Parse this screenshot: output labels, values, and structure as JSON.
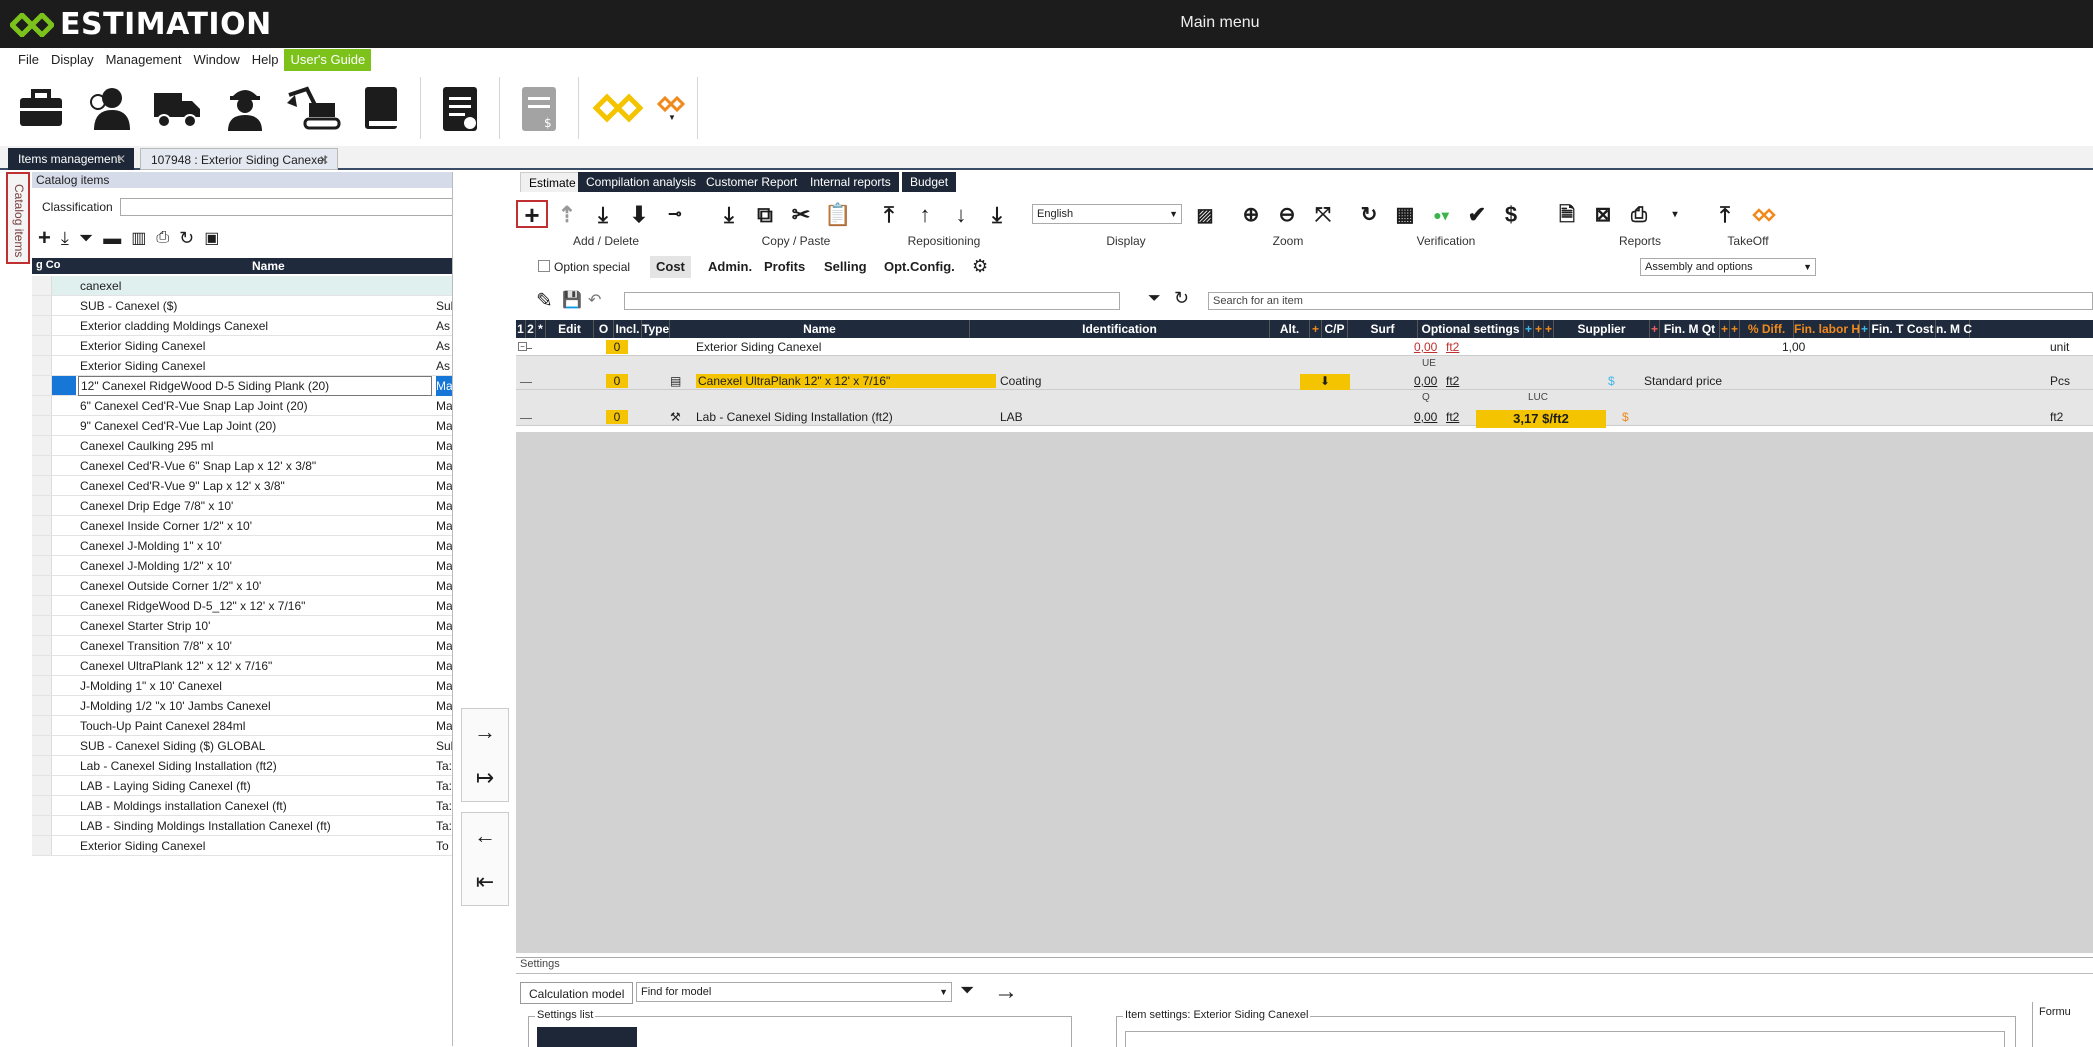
{
  "app": {
    "brand": "ESTIMATION",
    "window_title": "Main menu"
  },
  "menu": [
    "File",
    "Display",
    "Management",
    "Window",
    "Help",
    "User's Guide"
  ],
  "toolbar_icons": [
    "briefcase-icon",
    "customers-icon",
    "truck-icon",
    "worker-icon",
    "excavator-icon",
    "book-icon",
    "clipboard-icon",
    "price-list-icon",
    "logo-diamond-icon",
    "logo-small-icon"
  ],
  "doc_tabs": [
    "Items management",
    "107948 : Exterior Siding Canexel"
  ],
  "side_tab": "Catalog items",
  "catalog": {
    "header": "Catalog items",
    "classification_label": "Classification",
    "columns": {
      "col1": "g Co",
      "name": "Name"
    },
    "rows": [
      {
        "name": "canexel",
        "type": ""
      },
      {
        "name": "SUB - Canexel ($)",
        "type": "Sul"
      },
      {
        "name": "Exterior cladding Moldings Canexel",
        "type": "As"
      },
      {
        "name": "Exterior Siding Canexel",
        "type": "As"
      },
      {
        "name": "Exterior Siding Canexel",
        "type": "As"
      },
      {
        "name": "12\" Canexel RidgeWood D-5 Siding Plank (20)",
        "type": "Ma"
      },
      {
        "name": "6\" Canexel Ced'R-Vue Snap Lap Joint (20)",
        "type": "Ma"
      },
      {
        "name": "9\" Canexel Ced'R-Vue Lap Joint (20)",
        "type": "Ma"
      },
      {
        "name": "Canexel Caulking 295 ml",
        "type": "Ma"
      },
      {
        "name": "Canexel Ced'R-Vue 6\" Snap Lap x 12' x 3/8\"",
        "type": "Ma"
      },
      {
        "name": "Canexel Ced'R-Vue 9\" Lap x 12' x 3/8\"",
        "type": "Ma"
      },
      {
        "name": "Canexel Drip Edge 7/8\" x 10'",
        "type": "Ma"
      },
      {
        "name": "Canexel Inside Corner 1/2\" x 10'",
        "type": "Ma"
      },
      {
        "name": "Canexel J-Molding 1\" x 10'",
        "type": "Ma"
      },
      {
        "name": "Canexel J-Molding 1/2\" x 10'",
        "type": "Ma"
      },
      {
        "name": "Canexel Outside Corner 1/2\" x 10'",
        "type": "Ma"
      },
      {
        "name": "Canexel RidgeWood D-5_12\" x 12' x 7/16\"",
        "type": "Ma"
      },
      {
        "name": "Canexel Starter Strip 10'",
        "type": "Ma"
      },
      {
        "name": "Canexel Transition 7/8\" x 10'",
        "type": "Ma"
      },
      {
        "name": "Canexel UltraPlank 12\" x 12' x 7/16\"",
        "type": "Ma"
      },
      {
        "name": "J-Molding 1\" x 10' Canexel",
        "type": "Ma"
      },
      {
        "name": "J-Molding 1/2 \"x 10' Jambs Canexel",
        "type": "Ma"
      },
      {
        "name": "Touch-Up Paint Canexel 284ml",
        "type": "Ma"
      },
      {
        "name": "SUB - Canexel Siding ($) GLOBAL",
        "type": "Sul"
      },
      {
        "name": "Lab - Canexel Siding Installation (ft2)",
        "type": "Ta:"
      },
      {
        "name": "LAB - Laying Siding Canexel (ft)",
        "type": "Ta:"
      },
      {
        "name": "LAB - Moldings installation Canexel (ft)",
        "type": "Ta:"
      },
      {
        "name": "LAB - Sinding Moldings Installation Canexel (ft)",
        "type": "Ta:"
      },
      {
        "name": "Exterior Siding Canexel",
        "type": "To"
      }
    ]
  },
  "estimate": {
    "tabs": [
      "Estimate",
      "Compilation analysis",
      "Customer Report",
      "Internal reports",
      "Budget"
    ],
    "groups": [
      "Add / Delete",
      "Copy / Paste",
      "Repositioning",
      "Display",
      "Zoom",
      "Verification",
      "Reports",
      "TakeOff"
    ],
    "language": "English",
    "option_special": "Option special",
    "view_buttons": [
      "Cost",
      "Admin.",
      "Profits",
      "Selling",
      "Opt.Config."
    ],
    "assembly_select": "Assembly and options",
    "search_placeholder": "Search for an item",
    "columns": [
      "1",
      "2",
      "*",
      "Edit",
      "O",
      "Incl.",
      "Type",
      "Name",
      "Identification",
      "Alt.",
      "+",
      "C/P",
      "Surf",
      "Optional settings",
      "+",
      "+",
      "+",
      "Supplier",
      "+",
      "Fin. M Qt",
      "+",
      "+",
      "% Diff.",
      "Fin. labor H",
      "+",
      "Fin. T Cost",
      "n. M C"
    ],
    "rows": [
      {
        "o": "0",
        "name": "Exterior Siding Canexel",
        "surf": "0,00",
        "surf_unit": "ft2",
        "qty": "1,00",
        "unit": "unit"
      },
      {
        "label_top": "UE",
        "o": "0",
        "name": "Canexel UltraPlank 12\" x 12' x 7/16\"",
        "ident": "Coating",
        "surf": "0,00",
        "surf_unit": "ft2",
        "dollar": "$",
        "supplier": "Standard price",
        "unit": "Pcs"
      },
      {
        "label_top": "Q",
        "label_luc": "LUC",
        "o": "0",
        "name": "Lab - Canexel Siding Installation (ft2)",
        "ident": "LAB",
        "surf": "0,00",
        "surf_unit": "ft2",
        "opt": "3,17 $/ft2",
        "dollar": "$",
        "unit": "ft2"
      }
    ]
  },
  "settings": {
    "title": "Settings",
    "calc_model": "Calculation model",
    "find_model": "Find for model",
    "settings_list": "Settings list",
    "item_settings": "Item settings: Exterior Siding Canexel",
    "formula": "Formu"
  },
  "colors": {
    "accent": "#7cc21b",
    "dark": "#1f2b3c",
    "highlight": "#f4c400",
    "logo_yellow": "#f4c400",
    "logo_orange": "#f08a1c"
  }
}
